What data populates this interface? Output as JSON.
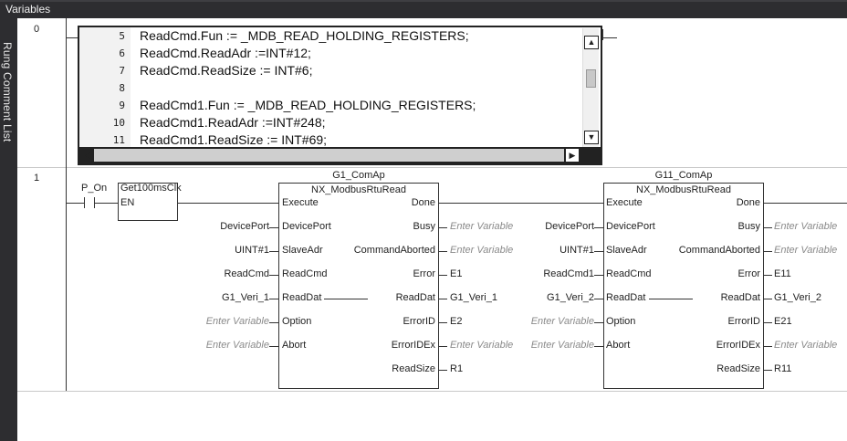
{
  "panel": {
    "title": "Variables",
    "side_tab": "Rung Comment List"
  },
  "rung0": {
    "number": "0",
    "code_lines": [
      {
        "ln": "5",
        "text": "ReadCmd.Fun := _MDB_READ_HOLDING_REGISTERS;"
      },
      {
        "ln": "6",
        "text": "ReadCmd.ReadAdr :=INT#12;"
      },
      {
        "ln": "7",
        "text": "ReadCmd.ReadSize := INT#6;"
      },
      {
        "ln": "8",
        "text": ""
      },
      {
        "ln": "9",
        "text": "ReadCmd1.Fun := _MDB_READ_HOLDING_REGISTERS;"
      },
      {
        "ln": "10",
        "text": "ReadCmd1.ReadAdr :=INT#248;"
      },
      {
        "ln": "11",
        "text": "ReadCmd1.ReadSize := INT#69;"
      }
    ],
    "scroll_up": "▲",
    "scroll_down": "▼",
    "scroll_left": "◀",
    "scroll_right": "▶"
  },
  "rung1": {
    "number": "1",
    "contact_var": "P_On",
    "clk_block": {
      "name": "Get100msClk",
      "pin": "EN"
    },
    "placeholder": "Enter Variable",
    "fb1": {
      "instance": "G1_ComAp",
      "type": "NX_ModbusRtuRead",
      "inputs": [
        "Execute",
        "DevicePort",
        "SlaveAdr",
        "ReadCmd",
        "ReadDat",
        "Option",
        "Abort"
      ],
      "outputs": [
        "Done",
        "Busy",
        "CommandAborted",
        "Error",
        "ReadDat",
        "ErrorID",
        "ErrorIDEx",
        "ReadSize"
      ],
      "in_vars": [
        "",
        "DevicePort",
        "UINT#1",
        "ReadCmd",
        "G1_Veri_1",
        "Enter Variable",
        "Enter Variable"
      ],
      "out_vars": [
        "",
        "Enter Variable",
        "Enter Variable",
        "E1",
        "G1_Veri_1",
        "E2",
        "Enter Variable",
        "R1"
      ]
    },
    "fb2": {
      "instance": "G11_ComAp",
      "type": "NX_ModbusRtuRead",
      "inputs": [
        "Execute",
        "DevicePort",
        "SlaveAdr",
        "ReadCmd",
        "ReadDat",
        "Option",
        "Abort"
      ],
      "outputs": [
        "Done",
        "Busy",
        "CommandAborted",
        "Error",
        "ReadDat",
        "ErrorID",
        "ErrorIDEx",
        "ReadSize"
      ],
      "in_vars": [
        "",
        "DevicePort",
        "UINT#1",
        "ReadCmd1",
        "G1_Veri_2",
        "Enter Variable",
        "Enter Variable"
      ],
      "out_vars": [
        "",
        "Enter Variable",
        "Enter Variable",
        "E11",
        "G1_Veri_2",
        "E21",
        "Enter Variable",
        "R11"
      ]
    }
  }
}
